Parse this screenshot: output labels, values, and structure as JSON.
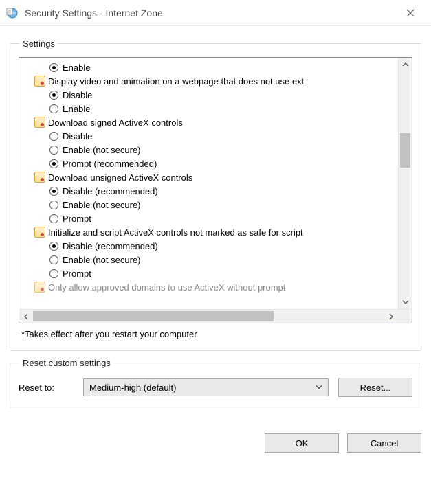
{
  "window": {
    "title": "Security Settings - Internet Zone"
  },
  "settings_group": {
    "legend": "Settings",
    "note": "*Takes effect after you restart your computer"
  },
  "tree": {
    "orphan_option": {
      "label": "Enable",
      "selected": true
    },
    "categories": [
      {
        "label": "Display video and animation on a webpage that does not use ext",
        "options": [
          {
            "label": "Disable",
            "selected": true
          },
          {
            "label": "Enable",
            "selected": false
          }
        ]
      },
      {
        "label": "Download signed ActiveX controls",
        "options": [
          {
            "label": "Disable",
            "selected": false
          },
          {
            "label": "Enable (not secure)",
            "selected": false
          },
          {
            "label": "Prompt (recommended)",
            "selected": true
          }
        ]
      },
      {
        "label": "Download unsigned ActiveX controls",
        "options": [
          {
            "label": "Disable (recommended)",
            "selected": true
          },
          {
            "label": "Enable (not secure)",
            "selected": false
          },
          {
            "label": "Prompt",
            "selected": false
          }
        ]
      },
      {
        "label": "Initialize and script ActiveX controls not marked as safe for script",
        "options": [
          {
            "label": "Disable (recommended)",
            "selected": true
          },
          {
            "label": "Enable (not secure)",
            "selected": false
          },
          {
            "label": "Prompt",
            "selected": false
          }
        ]
      }
    ],
    "cutoff_category": {
      "label": "Only allow approved domains to use ActiveX without prompt"
    }
  },
  "reset_group": {
    "legend": "Reset custom settings",
    "label": "Reset to:",
    "selected": "Medium-high (default)",
    "button": "Reset..."
  },
  "footer": {
    "ok": "OK",
    "cancel": "Cancel"
  }
}
